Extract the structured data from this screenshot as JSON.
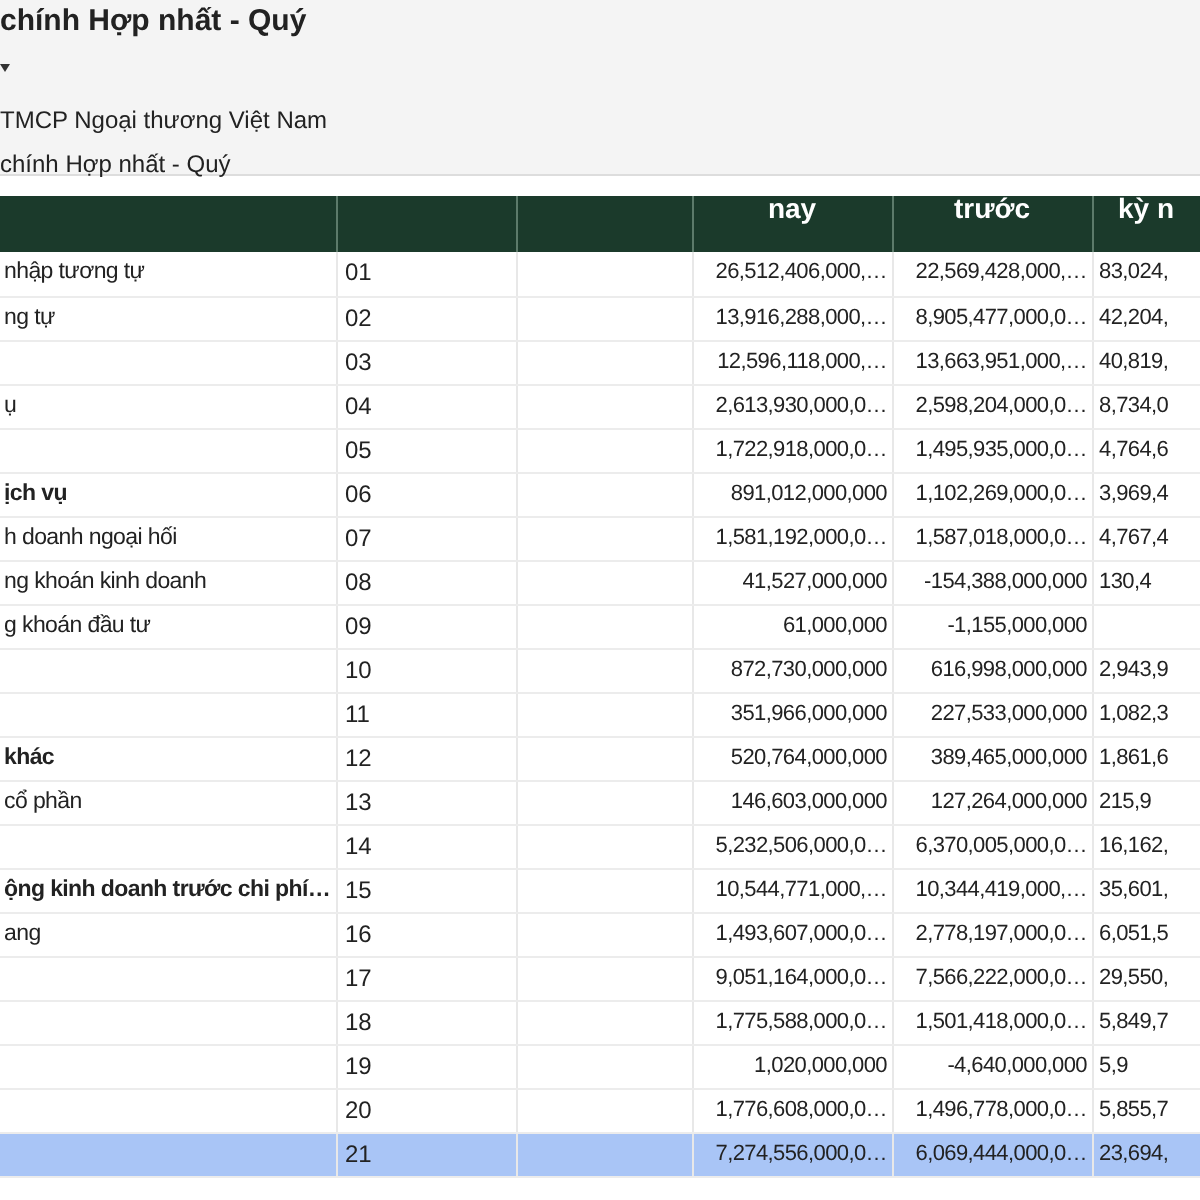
{
  "header": {
    "title": "chính Hợp nhất - Quý",
    "company": "TMCP Ngoại thương Việt Nam",
    "report": "chính Hợp nhất - Quý"
  },
  "table": {
    "column_headers": [
      "nay",
      "trước",
      "kỳ n"
    ],
    "rows": [
      {
        "label": "nhập tương tự",
        "code": "01",
        "values": [
          "26,512,406,000,…",
          "22,569,428,000,…",
          "83,024,"
        ],
        "bold": false,
        "selected": false
      },
      {
        "label": "ng tự",
        "code": "02",
        "values": [
          "13,916,288,000,…",
          "8,905,477,000,0…",
          "42,204,"
        ],
        "bold": false,
        "selected": false
      },
      {
        "code": "03",
        "values": [
          "12,596,118,000,…",
          "13,663,951,000,…",
          "40,819,"
        ],
        "bold": false,
        "selected": false
      },
      {
        "label": "ụ",
        "code": "04",
        "values": [
          "2,613,930,000,0…",
          "2,598,204,000,0…",
          "8,734,0"
        ],
        "bold": false,
        "selected": false
      },
      {
        "code": "05",
        "values": [
          "1,722,918,000,0…",
          "1,495,935,000,0…",
          "4,764,6"
        ],
        "bold": false,
        "selected": false
      },
      {
        "label": "ịch vụ",
        "code": "06",
        "values": [
          "891,012,000,000",
          "1,102,269,000,0…",
          "3,969,4"
        ],
        "bold": true,
        "selected": false
      },
      {
        "label": "h doanh ngoại hối",
        "code": "07",
        "values": [
          "1,581,192,000,0…",
          "1,587,018,000,0…",
          "4,767,4"
        ],
        "bold": false,
        "selected": false
      },
      {
        "label": "ng khoán kinh doanh",
        "code": "08",
        "values": [
          "41,527,000,000",
          "-154,388,000,000",
          "130,4"
        ],
        "bold": false,
        "selected": false
      },
      {
        "label": "g khoán đầu tư",
        "code": "09",
        "values": [
          "61,000,000",
          "-1,155,000,000"
        ],
        "bold": false,
        "selected": false
      },
      {
        "code": "10",
        "values": [
          "872,730,000,000",
          "616,998,000,000",
          "2,943,9"
        ],
        "bold": false,
        "selected": false
      },
      {
        "code": "11",
        "values": [
          "351,966,000,000",
          "227,533,000,000",
          "1,082,3"
        ],
        "bold": false,
        "selected": false
      },
      {
        "label": "khác",
        "code": "12",
        "values": [
          "520,764,000,000",
          "389,465,000,000",
          "1,861,6"
        ],
        "bold": true,
        "selected": false
      },
      {
        "label": "cổ phần",
        "code": "13",
        "values": [
          "146,603,000,000",
          "127,264,000,000",
          "215,9"
        ],
        "bold": false,
        "selected": false
      },
      {
        "code": "14",
        "values": [
          "5,232,506,000,0…",
          "6,370,005,000,0…",
          "16,162,"
        ],
        "bold": false,
        "selected": false
      },
      {
        "label": "ộng kinh doanh trước chi phí…",
        "code": "15",
        "values": [
          "10,544,771,000,…",
          "10,344,419,000,…",
          "35,601,"
        ],
        "bold": true,
        "selected": false
      },
      {
        "label": "ang",
        "code": "16",
        "values": [
          "1,493,607,000,0…",
          "2,778,197,000,0…",
          "6,051,5"
        ],
        "bold": false,
        "selected": false
      },
      {
        "code": "17",
        "values": [
          "9,051,164,000,0…",
          "7,566,222,000,0…",
          "29,550,"
        ],
        "bold": false,
        "selected": false
      },
      {
        "code": "18",
        "values": [
          "1,775,588,000,0…",
          "1,501,418,000,0…",
          "5,849,7"
        ],
        "bold": false,
        "selected": false
      },
      {
        "code": "19",
        "values": [
          "1,020,000,000",
          "-4,640,000,000",
          "5,9"
        ],
        "bold": false,
        "selected": false
      },
      {
        "code": "20",
        "values": [
          "1,776,608,000,0…",
          "1,496,778,000,0…",
          "5,855,7"
        ],
        "bold": false,
        "selected": false
      },
      {
        "code": "21",
        "values": [
          "7,274,556,000,0…",
          "6,069,444,000,0…",
          "23,694,"
        ],
        "bold": false,
        "selected": true
      }
    ]
  }
}
